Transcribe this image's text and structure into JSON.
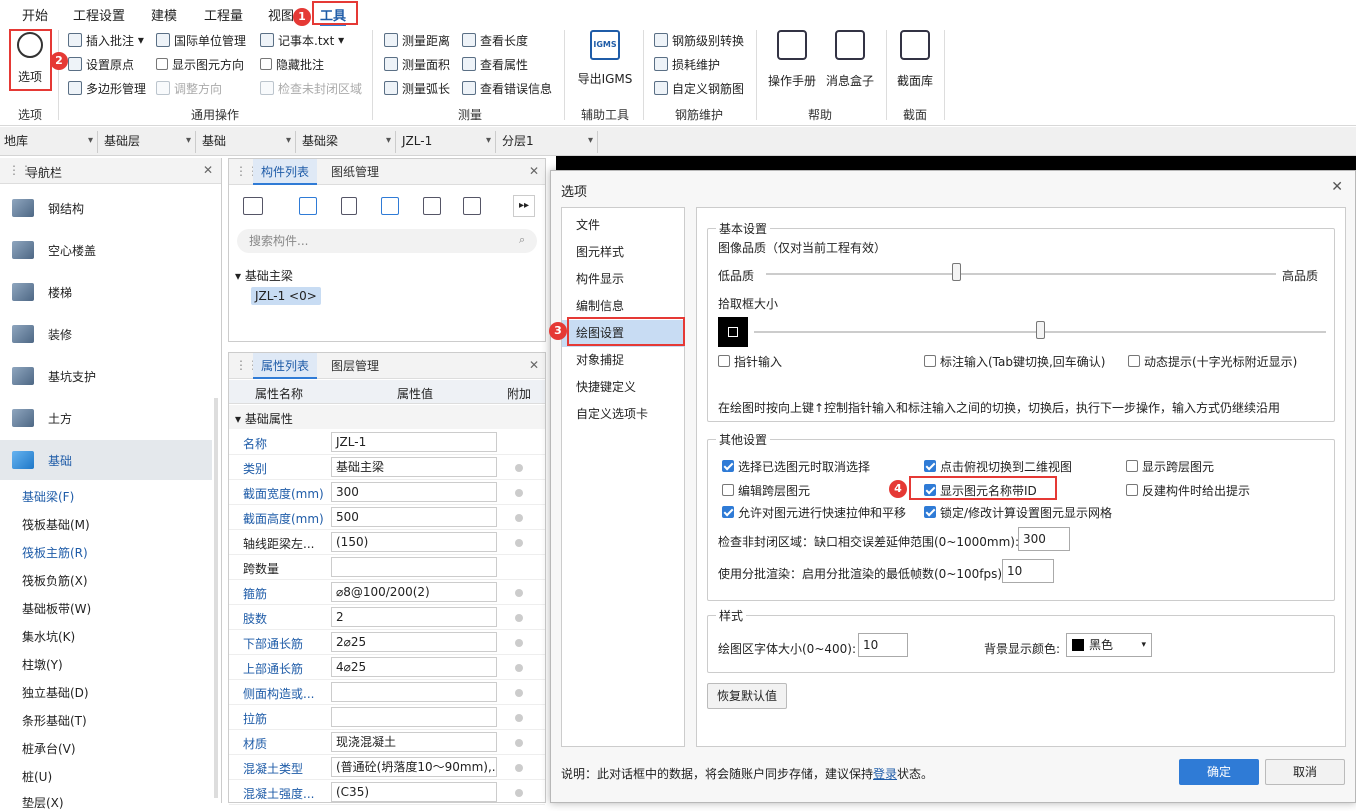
{
  "menubar": {
    "items": [
      "开始",
      "工程设置",
      "建模",
      "工程量",
      "视图",
      "工具"
    ]
  },
  "ribbon": {
    "options_label": "选项",
    "options_group": "选项",
    "general": {
      "group": "通用操作",
      "insert_note": "插入批注",
      "set_origin": "设置原点",
      "polygon_manage": "多边形管理",
      "intl_unit": "国际单位管理",
      "show_dir": "显示图元方向",
      "adjust_dir": "调整方向",
      "notepad": "记事本.txt",
      "hide_note": "隐藏批注",
      "check_unclosed": "检查未封闭区域"
    },
    "measure": {
      "group": "测量",
      "distance": "测量距离",
      "area": "测量面积",
      "arc": "测量弧长",
      "length": "查看长度",
      "attr": "查看属性",
      "errors": "查看错误信息"
    },
    "aux": {
      "group": "辅助工具",
      "igms_badge": "IGMS",
      "export": "导出IGMS"
    },
    "rebar": {
      "group": "钢筋维护",
      "convert": "钢筋级别转换",
      "loss": "损耗维护",
      "custom": "自定义钢筋图"
    },
    "help": {
      "group": "帮助",
      "manual": "操作手册",
      "msgbox": "消息盒子"
    },
    "section": {
      "group": "截面",
      "lib": "截面库"
    }
  },
  "badges": [
    "1",
    "2",
    "3",
    "4"
  ],
  "filterbar": [
    "地库",
    "基础层",
    "基础",
    "基础梁",
    "JZL-1",
    "分层1"
  ],
  "nav": {
    "title": "导航栏",
    "items": [
      "钢结构",
      "空心楼盖",
      "楼梯",
      "装修",
      "基坑支护",
      "土方",
      "基础"
    ],
    "subitems": [
      "基础梁(F)",
      "筏板基础(M)",
      "筏板主筋(R)",
      "筏板负筋(X)",
      "基础板带(W)",
      "集水坑(K)",
      "柱墩(Y)",
      "独立基础(D)",
      "条形基础(T)",
      "桩承台(V)",
      "桩(U)",
      "垫层(X)"
    ]
  },
  "comp": {
    "tab1": "构件列表",
    "tab2": "图纸管理",
    "search_placeholder": "搜索构件...",
    "tree_root": "基础主梁",
    "tree_child": "JZL-1 <0>"
  },
  "prop": {
    "tab1": "属性列表",
    "tab2": "图层管理",
    "headers": [
      "属性名称",
      "属性值",
      "附加"
    ],
    "section": "基础属性",
    "rows": [
      {
        "name": "名称",
        "value": "JZL-1"
      },
      {
        "name": "类别",
        "value": "基础主梁"
      },
      {
        "name": "截面宽度(mm)",
        "value": "300"
      },
      {
        "name": "截面高度(mm)",
        "value": "500"
      },
      {
        "name": "轴线距梁左...",
        "value": "(150)"
      },
      {
        "name": "跨数量",
        "value": ""
      },
      {
        "name": "箍筋",
        "value": "⌀8@100/200(2)"
      },
      {
        "name": "肢数",
        "value": "2"
      },
      {
        "name": "下部通长筋",
        "value": "2⌀25"
      },
      {
        "name": "上部通长筋",
        "value": "4⌀25"
      },
      {
        "name": "侧面构造或...",
        "value": ""
      },
      {
        "name": "拉筋",
        "value": ""
      },
      {
        "name": "材质",
        "value": "现浇混凝土"
      },
      {
        "name": "混凝土类型",
        "value": "(普通砼(坍落度10～90mm),..."
      },
      {
        "name": "混凝土强度...",
        "value": "(C35)"
      }
    ]
  },
  "dialog": {
    "title": "选项",
    "close": "✕",
    "left_items": [
      "文件",
      "图元样式",
      "构件显示",
      "编制信息",
      "绘图设置",
      "对象捕捉",
      "快捷键定义",
      "自定义选项卡"
    ],
    "basic": {
      "legend": "基本设置",
      "quality_label": "图像品质（仅对当前工程有效）",
      "low": "低品质",
      "high": "高品质",
      "pick_label": "拾取框大小",
      "cb1": "指针输入",
      "cb2": "标注输入(Tab键切换,回车确认)",
      "cb3": "动态提示(十字光标附近显示)",
      "note": "在绘图时按向上键↑控制指针输入和标注输入之间的切换，切换后，执行下一步操作，输入方式仍继续沿用"
    },
    "other": {
      "legend": "其他设置",
      "cb_a": "选择已选图元时取消选择",
      "cb_b": "点击俯视切换到二维视图",
      "cb_c": "显示跨层图元",
      "cb_d": "编辑跨层图元",
      "cb_e": "显示图元名称带ID",
      "cb_f": "反建构件时给出提示",
      "cb_g": "允许对图元进行快速拉伸和平移",
      "cb_h": "锁定/修改计算设置图元显示网格",
      "range_label": "检查非封闭区域：缺口相交误差延伸范围(0~1000mm):",
      "range_value": "300",
      "fps_label": "使用分批渲染：启用分批渲染的最低帧数(0~100fps):",
      "fps_value": "10"
    },
    "style": {
      "legend": "样式",
      "font_label": "绘图区字体大小(0~400):",
      "font_value": "10",
      "bg_label": "背景显示颜色:",
      "bg_value": "黑色"
    },
    "restore": "恢复默认值",
    "footer_note": "说明：此对话框中的数据，将会随账户同步存储，建议保持",
    "footer_link": "登录",
    "footer_tail": "状态。",
    "ok": "确定",
    "cancel": "取消"
  }
}
